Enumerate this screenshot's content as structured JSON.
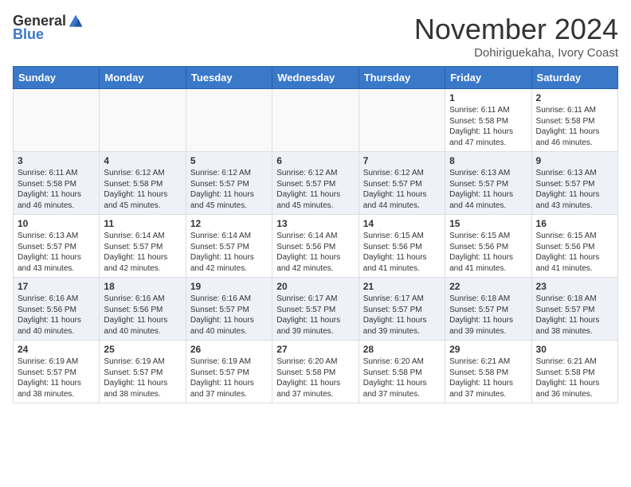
{
  "header": {
    "logo_general": "General",
    "logo_blue": "Blue",
    "month": "November 2024",
    "location": "Dohiriguekaha, Ivory Coast"
  },
  "days_of_week": [
    "Sunday",
    "Monday",
    "Tuesday",
    "Wednesday",
    "Thursday",
    "Friday",
    "Saturday"
  ],
  "weeks": [
    [
      {
        "day": "",
        "info": ""
      },
      {
        "day": "",
        "info": ""
      },
      {
        "day": "",
        "info": ""
      },
      {
        "day": "",
        "info": ""
      },
      {
        "day": "",
        "info": ""
      },
      {
        "day": "1",
        "info": "Sunrise: 6:11 AM\nSunset: 5:58 PM\nDaylight: 11 hours\nand 47 minutes."
      },
      {
        "day": "2",
        "info": "Sunrise: 6:11 AM\nSunset: 5:58 PM\nDaylight: 11 hours\nand 46 minutes."
      }
    ],
    [
      {
        "day": "3",
        "info": "Sunrise: 6:11 AM\nSunset: 5:58 PM\nDaylight: 11 hours\nand 46 minutes."
      },
      {
        "day": "4",
        "info": "Sunrise: 6:12 AM\nSunset: 5:58 PM\nDaylight: 11 hours\nand 45 minutes."
      },
      {
        "day": "5",
        "info": "Sunrise: 6:12 AM\nSunset: 5:57 PM\nDaylight: 11 hours\nand 45 minutes."
      },
      {
        "day": "6",
        "info": "Sunrise: 6:12 AM\nSunset: 5:57 PM\nDaylight: 11 hours\nand 45 minutes."
      },
      {
        "day": "7",
        "info": "Sunrise: 6:12 AM\nSunset: 5:57 PM\nDaylight: 11 hours\nand 44 minutes."
      },
      {
        "day": "8",
        "info": "Sunrise: 6:13 AM\nSunset: 5:57 PM\nDaylight: 11 hours\nand 44 minutes."
      },
      {
        "day": "9",
        "info": "Sunrise: 6:13 AM\nSunset: 5:57 PM\nDaylight: 11 hours\nand 43 minutes."
      }
    ],
    [
      {
        "day": "10",
        "info": "Sunrise: 6:13 AM\nSunset: 5:57 PM\nDaylight: 11 hours\nand 43 minutes."
      },
      {
        "day": "11",
        "info": "Sunrise: 6:14 AM\nSunset: 5:57 PM\nDaylight: 11 hours\nand 42 minutes."
      },
      {
        "day": "12",
        "info": "Sunrise: 6:14 AM\nSunset: 5:57 PM\nDaylight: 11 hours\nand 42 minutes."
      },
      {
        "day": "13",
        "info": "Sunrise: 6:14 AM\nSunset: 5:56 PM\nDaylight: 11 hours\nand 42 minutes."
      },
      {
        "day": "14",
        "info": "Sunrise: 6:15 AM\nSunset: 5:56 PM\nDaylight: 11 hours\nand 41 minutes."
      },
      {
        "day": "15",
        "info": "Sunrise: 6:15 AM\nSunset: 5:56 PM\nDaylight: 11 hours\nand 41 minutes."
      },
      {
        "day": "16",
        "info": "Sunrise: 6:15 AM\nSunset: 5:56 PM\nDaylight: 11 hours\nand 41 minutes."
      }
    ],
    [
      {
        "day": "17",
        "info": "Sunrise: 6:16 AM\nSunset: 5:56 PM\nDaylight: 11 hours\nand 40 minutes."
      },
      {
        "day": "18",
        "info": "Sunrise: 6:16 AM\nSunset: 5:56 PM\nDaylight: 11 hours\nand 40 minutes."
      },
      {
        "day": "19",
        "info": "Sunrise: 6:16 AM\nSunset: 5:57 PM\nDaylight: 11 hours\nand 40 minutes."
      },
      {
        "day": "20",
        "info": "Sunrise: 6:17 AM\nSunset: 5:57 PM\nDaylight: 11 hours\nand 39 minutes."
      },
      {
        "day": "21",
        "info": "Sunrise: 6:17 AM\nSunset: 5:57 PM\nDaylight: 11 hours\nand 39 minutes."
      },
      {
        "day": "22",
        "info": "Sunrise: 6:18 AM\nSunset: 5:57 PM\nDaylight: 11 hours\nand 39 minutes."
      },
      {
        "day": "23",
        "info": "Sunrise: 6:18 AM\nSunset: 5:57 PM\nDaylight: 11 hours\nand 38 minutes."
      }
    ],
    [
      {
        "day": "24",
        "info": "Sunrise: 6:19 AM\nSunset: 5:57 PM\nDaylight: 11 hours\nand 38 minutes."
      },
      {
        "day": "25",
        "info": "Sunrise: 6:19 AM\nSunset: 5:57 PM\nDaylight: 11 hours\nand 38 minutes."
      },
      {
        "day": "26",
        "info": "Sunrise: 6:19 AM\nSunset: 5:57 PM\nDaylight: 11 hours\nand 37 minutes."
      },
      {
        "day": "27",
        "info": "Sunrise: 6:20 AM\nSunset: 5:58 PM\nDaylight: 11 hours\nand 37 minutes."
      },
      {
        "day": "28",
        "info": "Sunrise: 6:20 AM\nSunset: 5:58 PM\nDaylight: 11 hours\nand 37 minutes."
      },
      {
        "day": "29",
        "info": "Sunrise: 6:21 AM\nSunset: 5:58 PM\nDaylight: 11 hours\nand 37 minutes."
      },
      {
        "day": "30",
        "info": "Sunrise: 6:21 AM\nSunset: 5:58 PM\nDaylight: 11 hours\nand 36 minutes."
      }
    ]
  ]
}
